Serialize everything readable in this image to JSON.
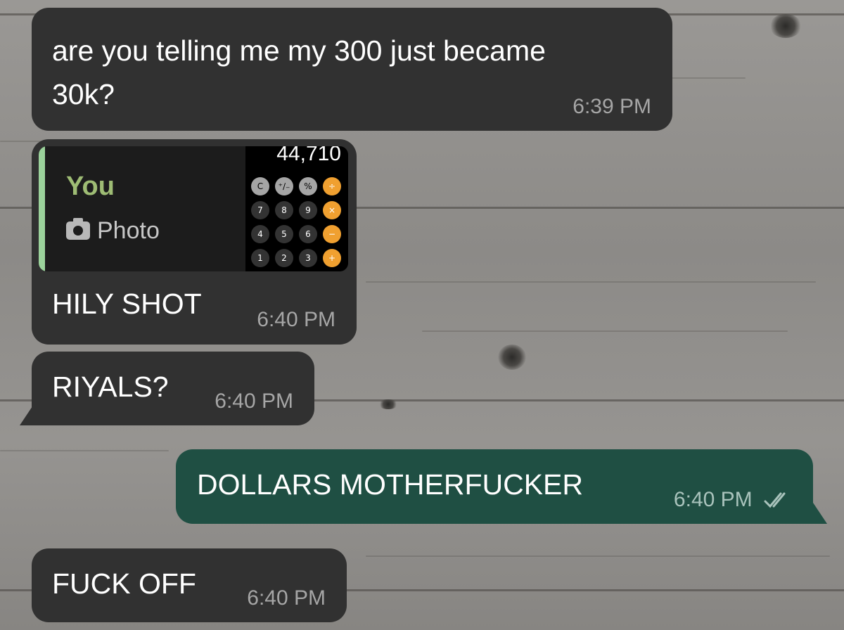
{
  "chat": {
    "messages": [
      {
        "direction": "incoming",
        "text": "are you telling me my 300 just became",
        "text2": "30k?",
        "time": "6:39 PM"
      },
      {
        "direction": "incoming",
        "reply": {
          "author": "You",
          "media_label": "Photo",
          "media_icon": "camera-icon",
          "thumbnail": {
            "display": "44,710",
            "keys": [
              "C",
              "⁺∕₋",
              "%",
              "÷",
              "7",
              "8",
              "9",
              "×",
              "4",
              "5",
              "6",
              "−",
              "1",
              "2",
              "3",
              "+"
            ]
          }
        },
        "text": "HILY SHOT",
        "time": "6:40 PM"
      },
      {
        "direction": "incoming",
        "text": "RIYALS?",
        "time": "6:40 PM"
      },
      {
        "direction": "outgoing",
        "text": "DOLLARS MOTHERFUCKER",
        "time": "6:40 PM",
        "status_icon": "double-check-icon"
      },
      {
        "direction": "incoming",
        "text": "FUCK OFF",
        "time": "6:40 PM"
      }
    ]
  },
  "colors": {
    "incoming_bubble": "#313131",
    "outgoing_bubble": "#1f4f43",
    "reply_bar": "#9bd29b",
    "reply_author": "#9ebc74",
    "calculator_operator": "#f0a030"
  }
}
